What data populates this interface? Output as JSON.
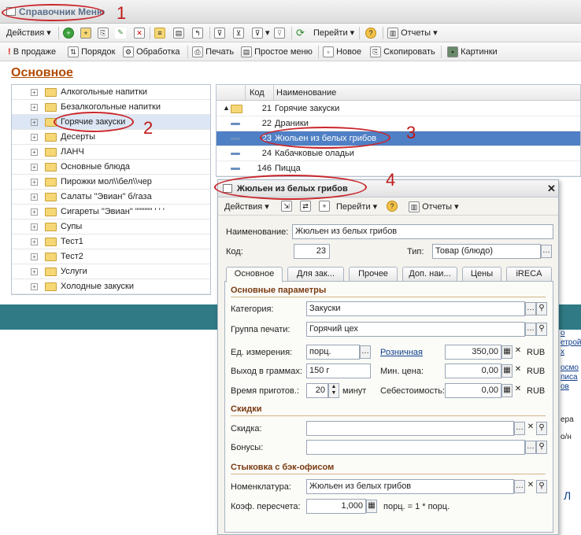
{
  "window": {
    "title": "Справочник Меню"
  },
  "toolbar1": {
    "actions": "Действия",
    "goto": "Перейти",
    "reports": "Отчеты"
  },
  "toolbar2": {
    "on_sale": "В продаже",
    "order": "Порядок",
    "processing": "Обработка",
    "print": "Печать",
    "simple_menu": "Простое меню",
    "new": "Новое",
    "copy": "Скопировать",
    "pictures": "Картинки"
  },
  "section": {
    "title": "Основное"
  },
  "tree": {
    "items": [
      "Алкогольные напитки",
      "Безалкогольные напитки",
      "Горячие закуски",
      "Десерты",
      "ЛАНЧ",
      "Основные блюда",
      "Пирожки мол\\\\бел\\\\чер",
      "Салаты \"Эвиан\" б/газа",
      "Сигареты \"Эвиан\" \"\"\"\"\"' ' ' '",
      "Супы",
      "Тест1",
      "Тест2",
      "Услуги",
      "Холодные закуски"
    ]
  },
  "list": {
    "col_code": "Код",
    "col_name": "Наименование",
    "rows": [
      {
        "code": "21",
        "name": "Горячие закуски"
      },
      {
        "code": "22",
        "name": "Драники"
      },
      {
        "code": "23",
        "name": "Жюльен из белых грибов"
      },
      {
        "code": "24",
        "name": "Кабачковые оладьи"
      },
      {
        "code": "146",
        "name": "Пицца"
      }
    ]
  },
  "annotations": [
    "1",
    "2",
    "3",
    "4"
  ],
  "form": {
    "title": "Жюльен из белых грибов",
    "toolbar": {
      "actions": "Действия",
      "goto": "Перейти",
      "reports": "Отчеты"
    },
    "name_label": "Наименование:",
    "name_value": "Жюльен из белых грибов",
    "code_label": "Код:",
    "code_value": "23",
    "type_label": "Тип:",
    "type_value": "Товар (блюдо)",
    "tabs": [
      "Основное",
      "Для зак...",
      "Прочее",
      "Доп. наи...",
      "Цены",
      "iRECA"
    ],
    "basic_group": "Основные параметры",
    "category_label": "Категория:",
    "category_value": "Закуски",
    "printgroup_label": "Группа печати:",
    "printgroup_value": "Горячий цех",
    "unit_label": "Ед. измерения:",
    "unit_value": "порц.",
    "retail_label": "Розничная",
    "retail_value": "350,00",
    "retail_cur": "RUB",
    "yield_label": "Выход в граммах:",
    "yield_value": "150 г",
    "minprice_label": "Мин. цена:",
    "minprice_value": "0,00",
    "minprice_cur": "RUB",
    "cooktime_label": "Время приготов.:",
    "cooktime_value": "20",
    "cooktime_unit": "минут",
    "cost_label": "Себестоимость:",
    "cost_value": "0,00",
    "cost_cur": "RUB",
    "discounts_group": "Скидки",
    "discount_label": "Скидка:",
    "bonus_label": "Бонусы:",
    "backoffice_group": "Стыковка с бэк-офисом",
    "nomen_label": "Номенклатура:",
    "nomen_value": "Жюльен из белых грибов",
    "coef_label": "Коэф. пересчета:",
    "coef_value": "1,000",
    "coef_note": "порц. = 1 * порц."
  }
}
